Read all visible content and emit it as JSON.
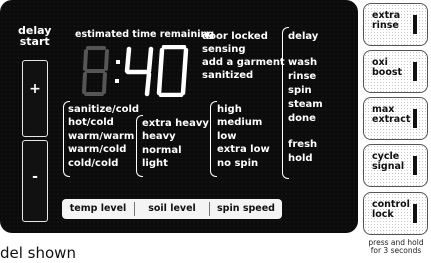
{
  "panel": {
    "delay_start": [
      "delay",
      "start"
    ],
    "plus": "+",
    "minus": "-",
    "estimated_time_label": "estimated time remaining",
    "time_display": "8:40",
    "door_status": [
      "door locked",
      "sensing",
      "add a garment",
      "sanitized"
    ],
    "temp_options": [
      "sanitize/cold",
      "hot/cold",
      "warm/warm",
      "warm/cold",
      "cold/cold"
    ],
    "soil_options": [
      "extra heavy",
      "heavy",
      "normal",
      "light"
    ],
    "spin_options": [
      "high",
      "medium",
      "low",
      "extra low",
      "no spin"
    ],
    "cycle_status": [
      "delay",
      "wash",
      "rinse",
      "spin",
      "steam",
      "done",
      "fresh",
      "hold"
    ],
    "level_buttons": [
      "temp level",
      "soil level",
      "spin speed"
    ]
  },
  "side_buttons": [
    {
      "label": [
        "extra",
        "rinse"
      ]
    },
    {
      "label": [
        "oxi",
        "boost"
      ]
    },
    {
      "label": [
        "max",
        "extract"
      ]
    },
    {
      "label": [
        "cycle",
        "signal"
      ]
    },
    {
      "label": [
        "control",
        "lock"
      ]
    }
  ],
  "press_hold": [
    "press and hold",
    "for 3 seconds"
  ],
  "caption": "del shown"
}
